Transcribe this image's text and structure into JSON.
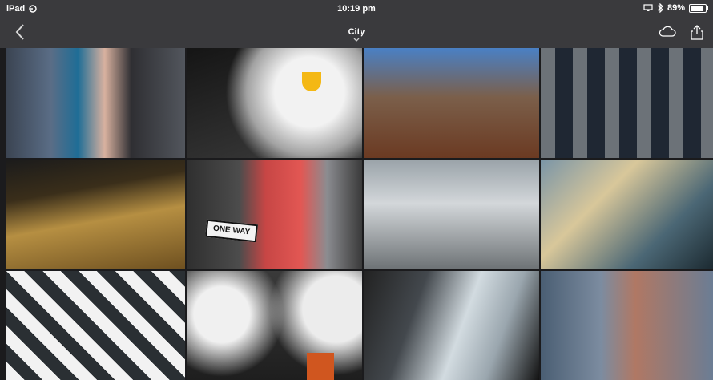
{
  "status_bar": {
    "device": "iPad",
    "time": "10:19 pm",
    "battery": "89%"
  },
  "nav": {
    "back_icon": "chevron-left-icon",
    "title": "City",
    "title_chevron": "chevron-down-icon",
    "cloud_icon": "cloud-icon",
    "share_icon": "share-icon"
  },
  "photos": [
    {
      "name": "photo-mural-woman"
    },
    {
      "name": "photo-steam-lamp"
    },
    {
      "name": "photo-building-reflection"
    },
    {
      "name": "photo-window-grid"
    },
    {
      "name": "photo-shadow-bridge"
    },
    {
      "name": "photo-one-way-mural",
      "sign_text": "ONE WAY"
    },
    {
      "name": "photo-street-crosswalk"
    },
    {
      "name": "photo-glass-birds"
    },
    {
      "name": "photo-zigzag-building"
    },
    {
      "name": "photo-steam-chimney"
    },
    {
      "name": "photo-skyscrapers-sky"
    },
    {
      "name": "photo-building-mural"
    }
  ],
  "colors": {
    "bar_bg": "#3a3a3d",
    "accent_lamp": "#f4b814",
    "accent_chimney": "#d0561f"
  }
}
